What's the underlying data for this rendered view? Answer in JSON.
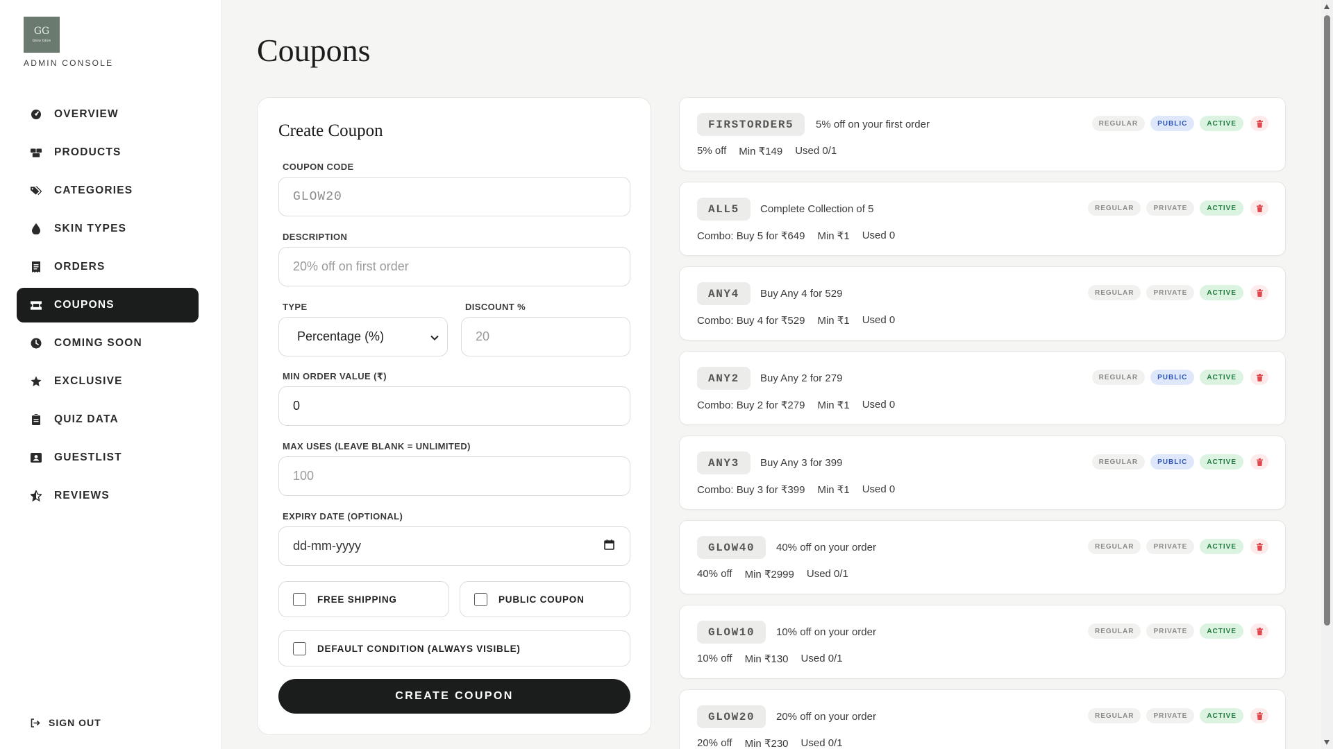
{
  "brand": {
    "logo_text": "GG",
    "logo_tiny": "Glow Glow",
    "subtitle": "ADMIN CONSOLE"
  },
  "sidebar": {
    "items": [
      {
        "label": "OVERVIEW",
        "icon": "gauge-icon"
      },
      {
        "label": "PRODUCTS",
        "icon": "boxes-icon"
      },
      {
        "label": "CATEGORIES",
        "icon": "tags-icon"
      },
      {
        "label": "SKIN TYPES",
        "icon": "droplet-icon"
      },
      {
        "label": "ORDERS",
        "icon": "receipt-icon"
      },
      {
        "label": "COUPONS",
        "icon": "ticket-icon",
        "active": true
      },
      {
        "label": "COMING SOON",
        "icon": "clock-icon"
      },
      {
        "label": "EXCLUSIVE",
        "icon": "star-icon"
      },
      {
        "label": "QUIZ DATA",
        "icon": "clipboard-icon"
      },
      {
        "label": "GUESTLIST",
        "icon": "address-card-icon"
      },
      {
        "label": "REVIEWS",
        "icon": "star-half-icon"
      }
    ],
    "signout": "SIGN OUT"
  },
  "page": {
    "title": "Coupons"
  },
  "form": {
    "title": "Create Coupon",
    "code_label": "COUPON CODE",
    "code_placeholder": "GLOW20",
    "description_label": "DESCRIPTION",
    "description_placeholder": "20% off on first order",
    "type_label": "TYPE",
    "type_value": "Percentage (%)",
    "discount_label": "DISCOUNT %",
    "discount_placeholder": "20",
    "min_order_label": "MIN ORDER VALUE (₹)",
    "min_order_value": "0",
    "max_uses_label": "MAX USES (LEAVE BLANK = UNLIMITED)",
    "max_uses_placeholder": "100",
    "expiry_label": "EXPIRY DATE (OPTIONAL)",
    "expiry_placeholder": "dd-mm-yyyy",
    "free_shipping_label": "FREE SHIPPING",
    "public_coupon_label": "PUBLIC COUPON",
    "default_condition_label": "DEFAULT CONDITION (ALWAYS VISIBLE)",
    "submit_label": "CREATE COUPON"
  },
  "badges": {
    "regular": "REGULAR",
    "public": "PUBLIC",
    "private": "PRIVATE",
    "active": "ACTIVE"
  },
  "coupons": [
    {
      "code": "FIRSTORDER5",
      "description": "5% off on your first order",
      "offer": "5% off",
      "min": "Min ₹149",
      "used": "Used 0/1",
      "visibility": "public"
    },
    {
      "code": "ALL5",
      "description": "Complete Collection of 5",
      "offer": "Combo: Buy 5 for ₹649",
      "min": "Min ₹1",
      "used": "Used 0",
      "visibility": "private"
    },
    {
      "code": "ANY4",
      "description": "Buy Any 4 for 529",
      "offer": "Combo: Buy 4 for ₹529",
      "min": "Min ₹1",
      "used": "Used 0",
      "visibility": "private"
    },
    {
      "code": "ANY2",
      "description": "Buy Any 2 for 279",
      "offer": "Combo: Buy 2 for ₹279",
      "min": "Min ₹1",
      "used": "Used 0",
      "visibility": "public"
    },
    {
      "code": "ANY3",
      "description": "Buy Any 3 for 399",
      "offer": "Combo: Buy 3 for ₹399",
      "min": "Min ₹1",
      "used": "Used 0",
      "visibility": "public"
    },
    {
      "code": "GLOW40",
      "description": "40% off on your order",
      "offer": "40% off",
      "min": "Min ₹2999",
      "used": "Used 0/1",
      "visibility": "private"
    },
    {
      "code": "GLOW10",
      "description": "10% off on your order",
      "offer": "10% off",
      "min": "Min ₹130",
      "used": "Used 0/1",
      "visibility": "private"
    },
    {
      "code": "GLOW20",
      "description": "20% off on your order",
      "offer": "20% off",
      "min": "Min ₹230",
      "used": "Used 0/1",
      "visibility": "private"
    }
  ],
  "colors": {
    "accent_dark": "#1b1d1c",
    "public_badge": "#2f56b5",
    "active_badge": "#1f7a3c",
    "delete": "#e0484d"
  }
}
